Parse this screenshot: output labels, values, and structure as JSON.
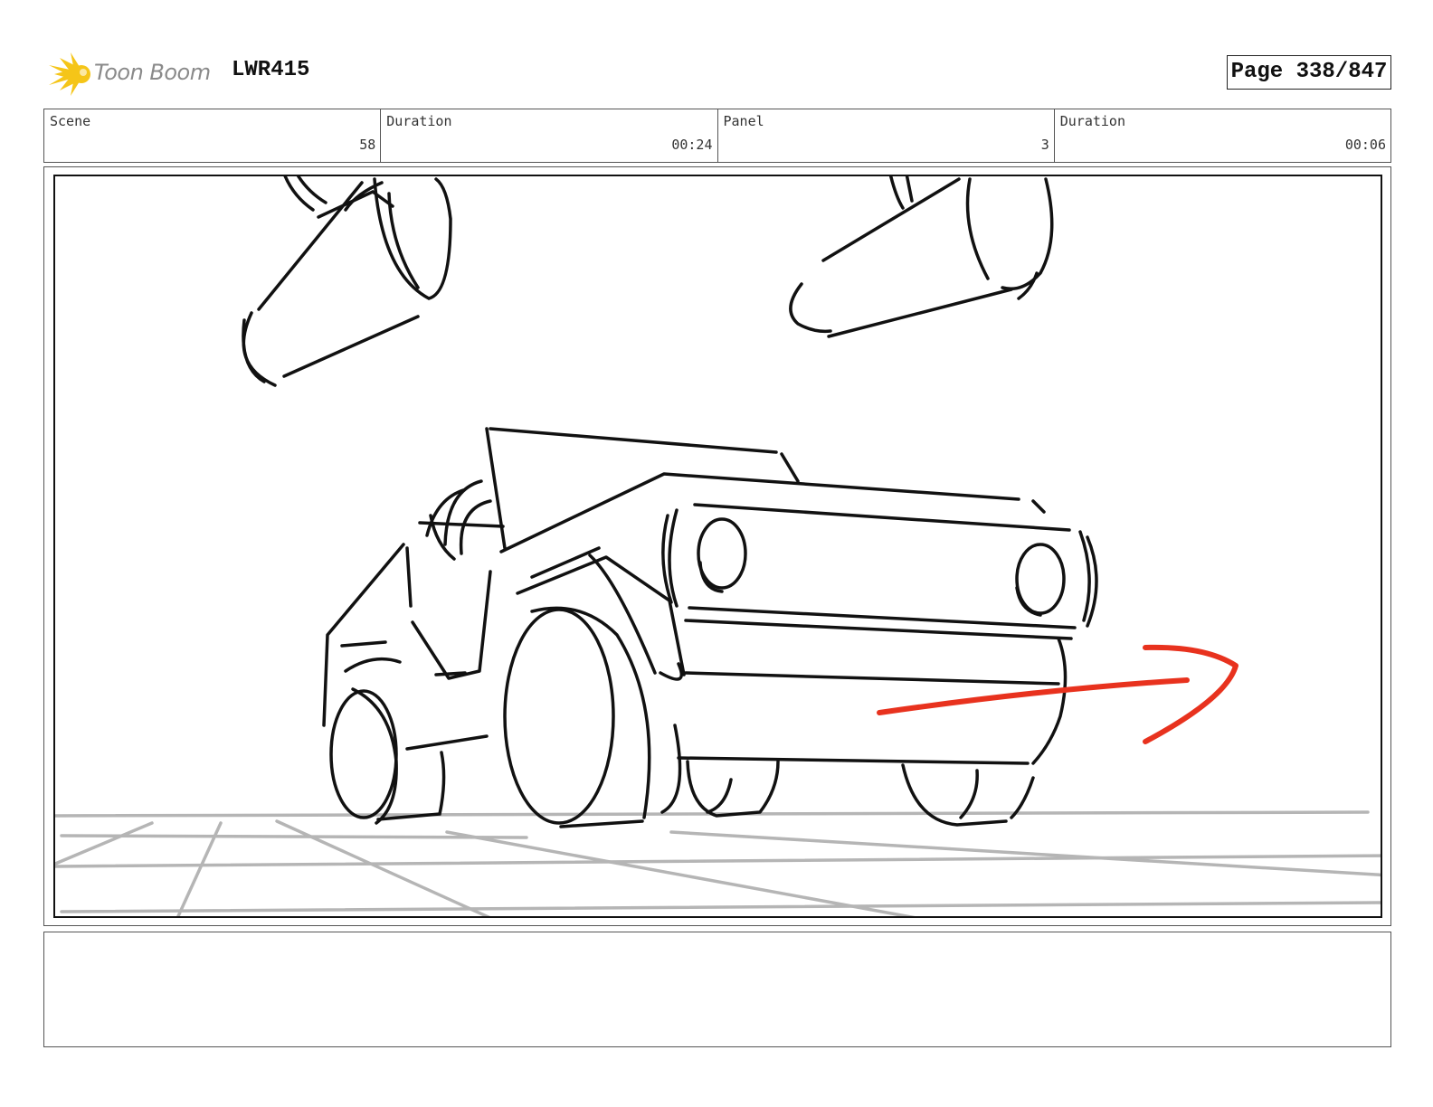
{
  "header": {
    "logo_text": "Toon Boom",
    "project_code": "LWR415",
    "page_label": "Page 338/847"
  },
  "info_bar": {
    "scene_label": "Scene",
    "scene_value": "58",
    "scene_duration_label": "Duration",
    "scene_duration_value": "00:24",
    "panel_label": "Panel",
    "panel_value": "3",
    "panel_duration_label": "Duration",
    "panel_duration_value": "00:06"
  },
  "panel": {
    "sketch_color": "#111111",
    "arrow_color": "#e8321e",
    "grid_color": "#b5b5b5",
    "icons": [
      "sun-logo-icon",
      "motion-arrow-icon"
    ]
  },
  "notes": {
    "text": ""
  },
  "colors": {
    "logo_sun": "#f5c518",
    "logo_text": "#8a8a8a",
    "border": "#555555"
  }
}
